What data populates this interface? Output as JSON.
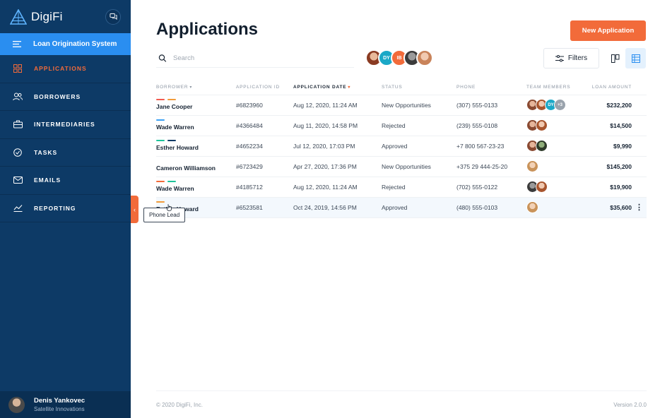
{
  "sidebar": {
    "brand": "DigiFi",
    "product": "Loan Origination System",
    "items": [
      {
        "label": "APPLICATIONS",
        "icon": "grid-icon",
        "active": true
      },
      {
        "label": "BORROWERS",
        "icon": "users-icon"
      },
      {
        "label": "INTERMEDIARIES",
        "icon": "briefcase-icon"
      },
      {
        "label": "TASKS",
        "icon": "check-circle-icon"
      },
      {
        "label": "EMAILS",
        "icon": "envelope-icon"
      },
      {
        "label": "REPORTING",
        "icon": "chart-line-icon"
      }
    ],
    "user": {
      "name": "Denis Yankovec",
      "org": "Satellite Innovations"
    }
  },
  "header": {
    "title": "Applications",
    "new_button": "New Application",
    "search_placeholder": "Search",
    "filters_label": "Filters",
    "avatar_initials": [
      "DY",
      "IB"
    ]
  },
  "table": {
    "columns": {
      "borrower": "BORROWER",
      "app_id": "APPLICATION ID",
      "app_date": "APPLICATION DATE",
      "status": "STATUS",
      "phone": "PHONE",
      "team": "TEAM MEMBERS",
      "amount": "LOAN AMOUNT"
    },
    "rows": [
      {
        "borrower": "Jane Cooper",
        "id": "#6823960",
        "date": "Aug 12, 2020, 11:24 AM",
        "status": "New Opportunities",
        "phone": "(307) 555-0133",
        "amount": "$232,200",
        "tags": [
          "#f25a4f",
          "#f29b3a"
        ],
        "extra": "+3",
        "extra_initials": "DY"
      },
      {
        "borrower": "Wade Warren",
        "id": "#4366484",
        "date": "Aug 11, 2020, 14:58 PM",
        "status": "Rejected",
        "phone": "(239) 555-0108",
        "amount": "$14,500",
        "tags": [
          "#3aa0f2"
        ]
      },
      {
        "borrower": "Esther Howard",
        "id": "#4652234",
        "date": "Jul 12, 2020, 17:03 PM",
        "status": "Approved",
        "phone": "+7 800 567-23-23",
        "amount": "$9,990",
        "tags": [
          "#1ec39a",
          "#0d3a66"
        ]
      },
      {
        "borrower": "Cameron Williamson",
        "id": "#6723429",
        "date": "Apr 27, 2020, 17:36 PM",
        "status": "New Opportunities",
        "phone": "+375 29 444-25-20",
        "amount": "$145,200",
        "tags": []
      },
      {
        "borrower": "Wade Warren",
        "id": "#4185712",
        "date": "Aug 12, 2020, 11:24 AM",
        "status": "Rejected",
        "phone": "(702) 555-0122",
        "amount": "$19,900",
        "tags": [
          "#f26b3a",
          "#1ec39a"
        ]
      },
      {
        "borrower": "Esther Howard",
        "id": "#6523581",
        "date": "Oct 24, 2019, 14:56 PM",
        "status": "Approved",
        "phone": "(480) 555-0103",
        "amount": "$35,600",
        "tags": [
          "#f29b3a"
        ]
      }
    ]
  },
  "tooltip": "Phone Lead",
  "footer": {
    "copyright": "© 2020 DigiFi, Inc.",
    "version": "Version 2.0.0"
  },
  "colors": {
    "sidebar": "#0d3a66",
    "accent": "#f26b3a",
    "product_bar": "#2a8ef0"
  }
}
